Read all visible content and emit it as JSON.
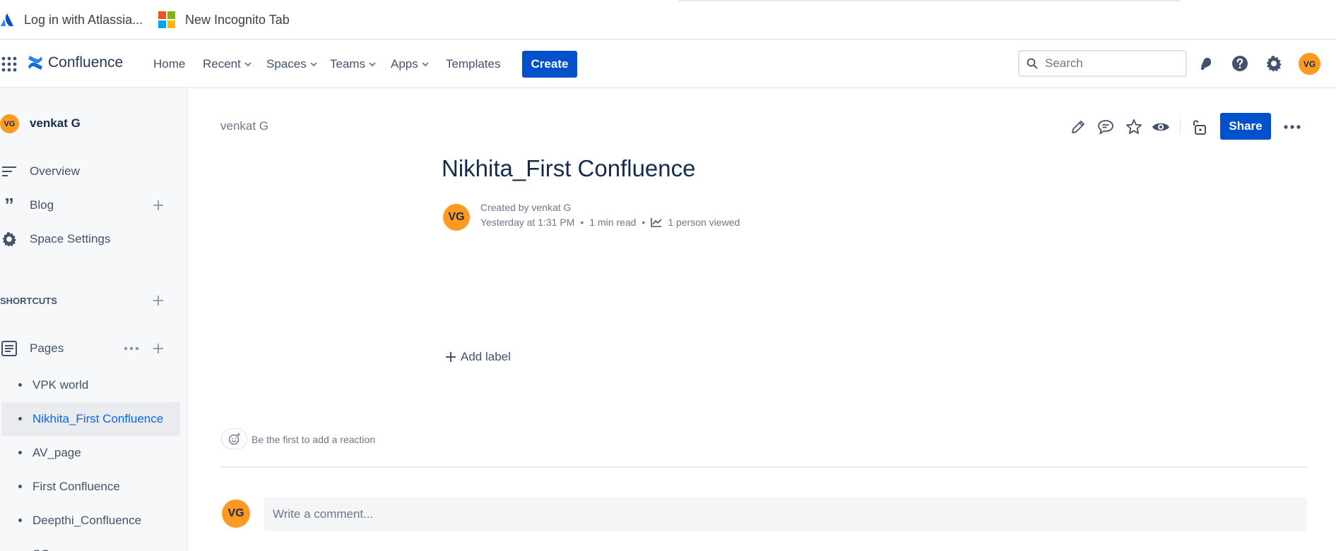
{
  "bookmarks": [
    {
      "label": "Log in with Atlassia...",
      "icon": "atlassian-icon"
    },
    {
      "label": "New Incognito Tab",
      "icon": "microsoft-icon"
    }
  ],
  "topnav": {
    "app_name": "Confluence",
    "items": [
      {
        "label": "Home"
      },
      {
        "label": "Recent"
      },
      {
        "label": "Spaces"
      },
      {
        "label": "Teams"
      },
      {
        "label": "Apps"
      },
      {
        "label": "Templates"
      }
    ],
    "create_label": "Create",
    "search_placeholder": "Search",
    "avatar_initials": "VG"
  },
  "sidebar": {
    "space_avatar": "VG",
    "space_name": "venkat G",
    "items": [
      {
        "label": "Overview"
      },
      {
        "label": "Blog"
      },
      {
        "label": "Space Settings"
      }
    ],
    "shortcuts_label": "SHORTCUTS",
    "pages_label": "Pages",
    "pages": [
      {
        "label": "VPK world"
      },
      {
        "label": "Nikhita_First Confluence",
        "active": true
      },
      {
        "label": "AV_page"
      },
      {
        "label": "First Confluence"
      },
      {
        "label": "Deepthi_Confluence"
      },
      {
        "label": "SG"
      }
    ]
  },
  "page": {
    "breadcrumb": "venkat G",
    "title": "Nikhita_First Confluence",
    "author_avatar": "VG",
    "created_by": "Created by venkat G",
    "time": "Yesterday at 1:31 PM",
    "read_time": "1 min read",
    "views": "1 person viewed",
    "share_label": "Share",
    "add_label": "Add label",
    "reaction_prompt": "Be the first to add a reaction",
    "comment_avatar": "VG",
    "comment_placeholder": "Write a comment..."
  },
  "colors": {
    "primary": "#0052cc",
    "avatar": "#ff991f",
    "text": "#172b4d",
    "subtle": "#6b778c"
  }
}
